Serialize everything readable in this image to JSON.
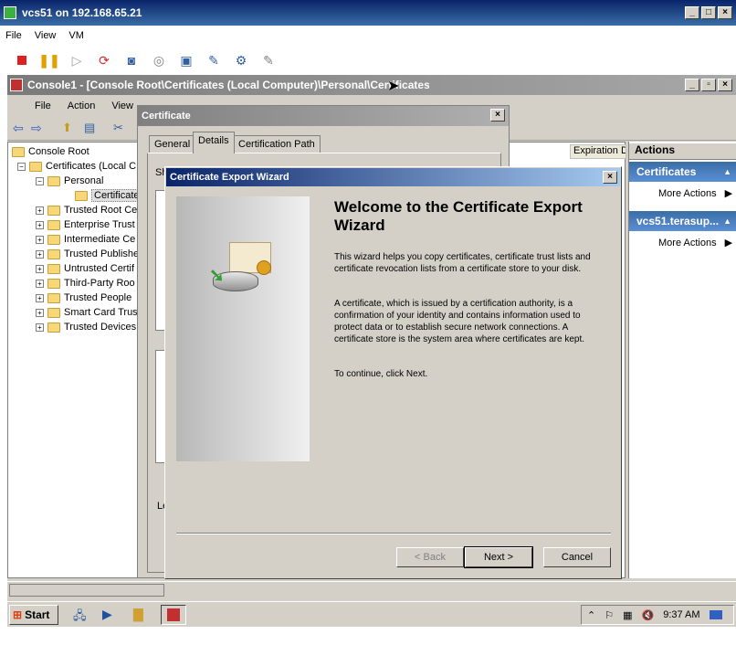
{
  "vm_window": {
    "title": "vcs51 on 192.168.65.21",
    "menu": [
      "File",
      "View",
      "VM"
    ]
  },
  "mmc": {
    "title": "Console1 - [Console Root\\Certificates (Local Computer)\\Personal\\Certificates]",
    "menu": [
      "File",
      "Action",
      "View"
    ],
    "tree": [
      {
        "label": "Console Root",
        "level": 0,
        "expander": ""
      },
      {
        "label": "Certificates (Local C",
        "level": 1,
        "expander": "−"
      },
      {
        "label": "Personal",
        "level": 2,
        "expander": "−"
      },
      {
        "label": "Certificates",
        "level": 3,
        "expander": ""
      },
      {
        "label": "Trusted Root Ce",
        "level": 2,
        "expander": "+"
      },
      {
        "label": "Enterprise Trust",
        "level": 2,
        "expander": "+"
      },
      {
        "label": "Intermediate Ce",
        "level": 2,
        "expander": "+"
      },
      {
        "label": "Trusted Publishe",
        "level": 2,
        "expander": "+"
      },
      {
        "label": "Untrusted Certif",
        "level": 2,
        "expander": "+"
      },
      {
        "label": "Third-Party Roo",
        "level": 2,
        "expander": "+"
      },
      {
        "label": "Trusted People",
        "level": 2,
        "expander": "+"
      },
      {
        "label": "Smart Card Trus",
        "level": 2,
        "expander": "+"
      },
      {
        "label": "Trusted Devices",
        "level": 2,
        "expander": "+"
      }
    ],
    "column_header": "Expiration D",
    "actions": {
      "header": "Actions",
      "sections": [
        {
          "title": "Certificates",
          "item": "More Actions"
        },
        {
          "title": "vcs51.terasup...",
          "item": "More Actions"
        }
      ]
    }
  },
  "cert_dialog": {
    "title": "Certificate",
    "tabs": [
      "General",
      "Details",
      "Certification Path"
    ],
    "partial_label_1": "Sh",
    "partial_label_2": "Le"
  },
  "wizard": {
    "title": "Certificate Export Wizard",
    "heading": "Welcome to the Certificate Export Wizard",
    "para1": "This wizard helps you copy certificates, certificate trust lists and certificate revocation lists from a certificate store to your disk.",
    "para2": "A certificate, which is issued by a certification authority, is a confirmation of your identity and contains information used to protect data or to establish secure network connections. A certificate store is the system area where certificates are kept.",
    "para3": "To continue, click Next.",
    "back_label": "< Back",
    "next_label": "Next >",
    "cancel_label": "Cancel"
  },
  "taskbar": {
    "start_label": "Start",
    "clock": "9:37 AM"
  }
}
